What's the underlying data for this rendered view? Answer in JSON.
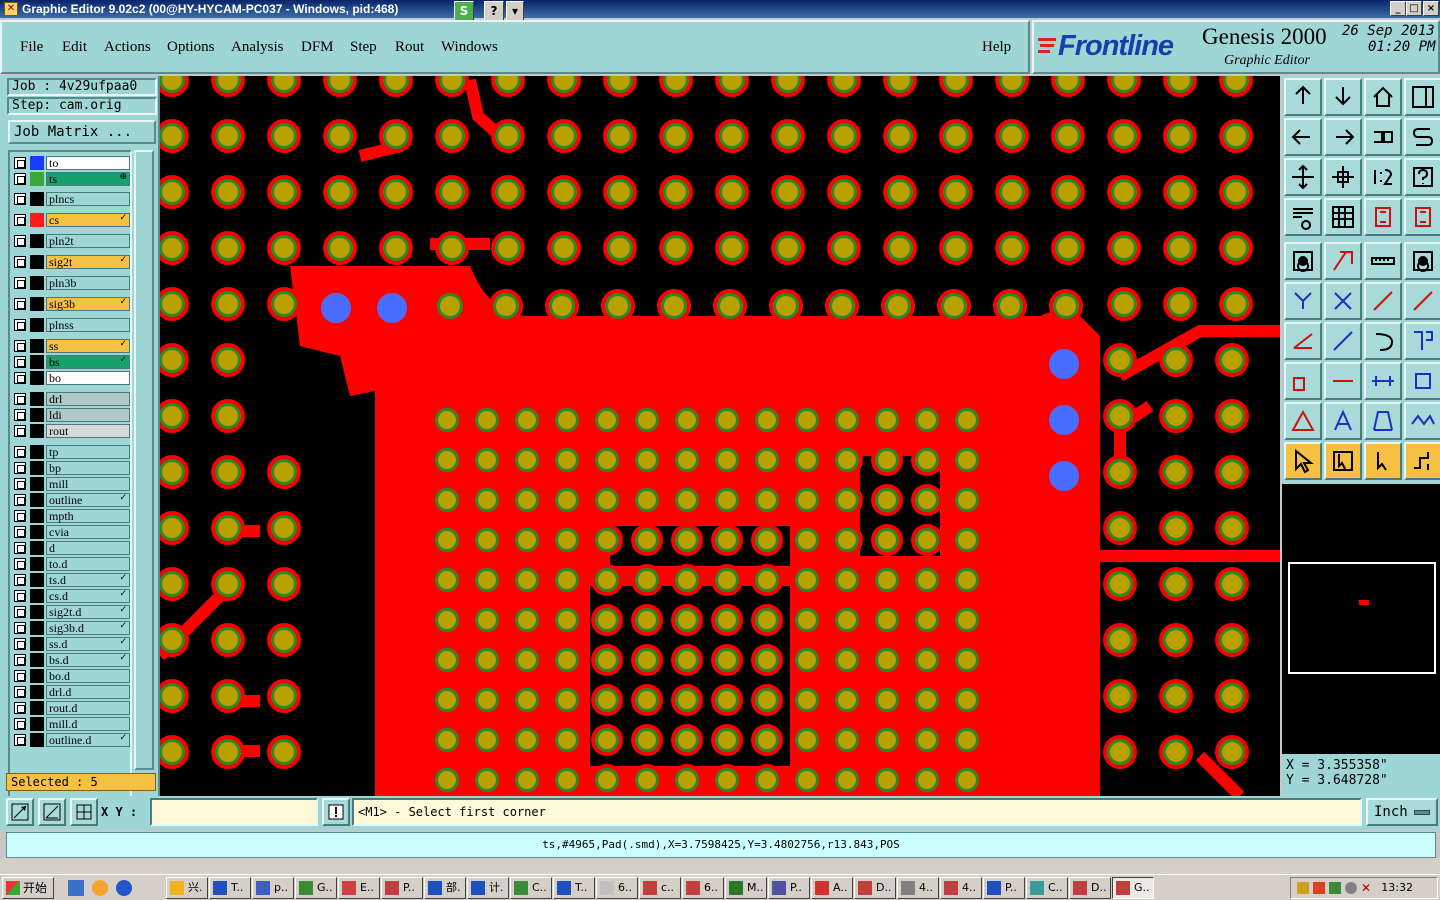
{
  "window": {
    "title": "Graphic Editor 9.02c2 (00@HY-HYCAM-PC037 - Windows, pid:468)",
    "extra_buttons": [
      "S",
      "?",
      "▾"
    ],
    "controls": [
      "_",
      "□",
      "×"
    ]
  },
  "menu": {
    "items": [
      "File",
      "Edit",
      "Actions",
      "Options",
      "Analysis",
      "DFM",
      "Step",
      "Rout",
      "Windows"
    ],
    "help": "Help"
  },
  "brand": {
    "logo": "Frontline",
    "product": "Genesis 2000",
    "subtitle": "Graphic Editor",
    "date": "26 Sep 2013",
    "time": "01:20 PM"
  },
  "job": {
    "job_label": "Job : 4v29ufpaa0",
    "step_label": "Step: cam.orig",
    "matrix_button": "Job Matrix ..."
  },
  "layers": [
    {
      "name": "to",
      "bg": "#ffffff",
      "swatch": "#1a3cff",
      "mark": ""
    },
    {
      "name": "ts",
      "bg": "#1aa070",
      "swatch": "#3aa83a",
      "mark": "⊕"
    },
    {
      "name": "plncs",
      "bg": "#9ed6d6",
      "swatch": "#000000",
      "mark": ""
    },
    {
      "name": "cs",
      "bg": "#f6c043",
      "swatch": "#ff1a1a",
      "mark": "✓"
    },
    {
      "name": "pln2t",
      "bg": "#9ed6d6",
      "swatch": "#000000",
      "mark": ""
    },
    {
      "name": "sig2t",
      "bg": "#f6c043",
      "swatch": "#000000",
      "mark": "✓"
    },
    {
      "name": "pln3b",
      "bg": "#9ed6d6",
      "swatch": "#000000",
      "mark": ""
    },
    {
      "name": "sig3b",
      "bg": "#f6c043",
      "swatch": "#000000",
      "mark": "✓"
    },
    {
      "name": "plnss",
      "bg": "#9ed6d6",
      "swatch": "#000000",
      "mark": ""
    },
    {
      "name": "ss",
      "bg": "#f6c043",
      "swatch": "#000000",
      "mark": "✓"
    },
    {
      "name": "bs",
      "bg": "#1aa070",
      "swatch": "#000000",
      "mark": "✓"
    },
    {
      "name": "bo",
      "bg": "#ffffff",
      "swatch": "#000000",
      "mark": ""
    },
    {
      "name": "drl",
      "bg": "#b0c8c8",
      "swatch": "#000000",
      "mark": ""
    },
    {
      "name": "ldi",
      "bg": "#b0c8c8",
      "swatch": "#000000",
      "mark": ""
    },
    {
      "name": "rout",
      "bg": "#d8d8d8",
      "swatch": "#000000",
      "mark": ""
    },
    {
      "name": "tp",
      "bg": "#9ed6d6",
      "swatch": "#000000",
      "mark": ""
    },
    {
      "name": "bp",
      "bg": "#9ed6d6",
      "swatch": "#000000",
      "mark": ""
    },
    {
      "name": "mill",
      "bg": "#9ed6d6",
      "swatch": "#000000",
      "mark": ""
    },
    {
      "name": "outline",
      "bg": "#9ed6d6",
      "swatch": "#000000",
      "mark": "✓"
    },
    {
      "name": "mpth",
      "bg": "#9ed6d6",
      "swatch": "#000000",
      "mark": ""
    },
    {
      "name": "cvia",
      "bg": "#9ed6d6",
      "swatch": "#000000",
      "mark": ""
    },
    {
      "name": "d",
      "bg": "#9ed6d6",
      "swatch": "#000000",
      "mark": ""
    },
    {
      "name": "to.d",
      "bg": "#9ed6d6",
      "swatch": "#000000",
      "mark": ""
    },
    {
      "name": "ts.d",
      "bg": "#9ed6d6",
      "swatch": "#000000",
      "mark": "✓"
    },
    {
      "name": "cs.d",
      "bg": "#9ed6d6",
      "swatch": "#000000",
      "mark": "✓"
    },
    {
      "name": "sig2t.d",
      "bg": "#9ed6d6",
      "swatch": "#000000",
      "mark": "✓"
    },
    {
      "name": "sig3b.d",
      "bg": "#9ed6d6",
      "swatch": "#000000",
      "mark": "✓"
    },
    {
      "name": "ss.d",
      "bg": "#9ed6d6",
      "swatch": "#000000",
      "mark": "✓"
    },
    {
      "name": "bs.d",
      "bg": "#9ed6d6",
      "swatch": "#000000",
      "mark": "✓"
    },
    {
      "name": "bo.d",
      "bg": "#9ed6d6",
      "swatch": "#000000",
      "mark": ""
    },
    {
      "name": "drl.d",
      "bg": "#9ed6d6",
      "swatch": "#000000",
      "mark": ""
    },
    {
      "name": "rout.d",
      "bg": "#9ed6d6",
      "swatch": "#000000",
      "mark": ""
    },
    {
      "name": "mill.d",
      "bg": "#9ed6d6",
      "swatch": "#000000",
      "mark": ""
    },
    {
      "name": "outline.d",
      "bg": "#9ed6d6",
      "swatch": "#000000",
      "mark": "✓"
    }
  ],
  "selected_label": "Selected : 5",
  "colors": {
    "copper": "#ff0000",
    "pad_fill": "#b8a000",
    "pad_ring": "#2a8a2a",
    "selected_pad": "#4a6cff",
    "panel": "#9ed6d6",
    "highlight": "#f6c043"
  },
  "coords": {
    "x": "X = 3.355358\"",
    "y": "Y = 3.648728\""
  },
  "bottom": {
    "xy_label": "X Y :",
    "xy_value": "",
    "prompt": "<M1> - Select first corner",
    "unit": "Inch",
    "status": "ts,#4965,Pad(.smd),X=3.7598425,Y=3.4802756,r13.843,POS"
  },
  "taskbar": {
    "start": "开始",
    "tasks": [
      "兴.",
      "T..",
      "p..",
      "G..",
      "E..",
      "P..",
      "部.",
      "计.",
      "C..",
      "T..",
      "6..",
      "c..",
      "6..",
      "M..",
      "P..",
      "A..",
      "D..",
      "4..",
      "4..",
      "P..",
      "C..",
      "D..",
      "G.."
    ],
    "clock": "13:32"
  }
}
